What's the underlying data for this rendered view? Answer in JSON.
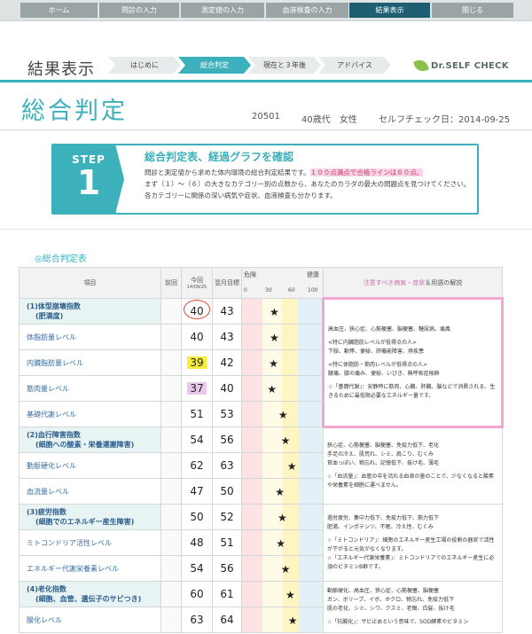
{
  "nav": {
    "items": [
      {
        "label": "ホーム"
      },
      {
        "label": "問診の入力"
      },
      {
        "label": "測定値の入力"
      },
      {
        "label": "血液検査の入力"
      },
      {
        "label": "結果表示"
      },
      {
        "label": "閉じる"
      }
    ],
    "active_index": 4
  },
  "header": {
    "title": "結果表示",
    "breadcrumbs": [
      "はじめに",
      "総合判定",
      "現在と３年後",
      "アドバイス"
    ],
    "active_crumb": 1,
    "logo_text": "Dr.SELF CHECK"
  },
  "page": {
    "title": "総合判定",
    "id": "20501",
    "profile": "40歳代　女性",
    "check_date": "セルフチェック日：2014-09-25"
  },
  "step": {
    "label": "STEP",
    "number": "1",
    "heading": "総合判定表、経過グラフを確認",
    "body_1": "問診と測定値から求めた体内環境の総合判定結果です。",
    "highlight": "１００点満点で合格ラインは６０点。",
    "body_2": "まず（１）～（６）の大きなカテゴリー別の点数から、あなたのカラダの最大の問題点を見つけてください。各カテゴリーに関係の深い病気や症状、血液検査も分かります。"
  },
  "section": {
    "title": "総合判定表",
    "bullet": "◎"
  },
  "table": {
    "headers": {
      "item": "項目",
      "prev": "前回",
      "now": "今回",
      "now_date": "14/09/25",
      "target": "翌月目標",
      "danger": "危険",
      "healthy": "健康",
      "ticks": [
        "0",
        "30",
        "60",
        "100"
      ],
      "notes_pink": "注意すべき病気・症状",
      "notes_rest": "＆用語の解説"
    },
    "rows": [
      {
        "item": "(1)体型崩壊指数",
        "item_sub": "(肥満度)",
        "category": true,
        "prev": "",
        "now": "40",
        "target": "43",
        "score": 40,
        "mark": "circle"
      },
      {
        "item": "体脂肪量レベル",
        "category": false,
        "prev": "",
        "now": "40",
        "target": "43",
        "score": 40,
        "mark": ""
      },
      {
        "item": "内臓脂肪量レベル",
        "category": false,
        "prev": "",
        "now": "39",
        "target": "42",
        "score": 39,
        "mark": "yellow"
      },
      {
        "item": "筋肉量レベル",
        "category": false,
        "prev": "",
        "now": "37",
        "target": "40",
        "score": 37,
        "mark": "purple"
      },
      {
        "item": "基礎代謝レベル",
        "category": false,
        "prev": "",
        "now": "51",
        "target": "53",
        "score": 51,
        "mark": ""
      },
      {
        "item": "(2)血行障害指数",
        "item_sub": "(細胞への酸素・栄養運搬障害)",
        "category": true,
        "prev": "",
        "now": "54",
        "target": "56",
        "score": 54,
        "mark": ""
      },
      {
        "item": "動脈硬化レベル",
        "category": false,
        "prev": "",
        "now": "62",
        "target": "63",
        "score": 62,
        "mark": ""
      },
      {
        "item": "血流量レベル",
        "category": false,
        "prev": "",
        "now": "47",
        "target": "50",
        "score": 47,
        "mark": ""
      },
      {
        "item": "(3)疲労指数",
        "item_sub": "(細胞でのエネルギー産生障害)",
        "category": true,
        "prev": "",
        "now": "50",
        "target": "52",
        "score": 50,
        "mark": ""
      },
      {
        "item": "ミトコンドリア活性レベル",
        "category": false,
        "prev": "",
        "now": "48",
        "target": "51",
        "score": 48,
        "mark": ""
      },
      {
        "item": "エネルギー代謝栄養素レベル",
        "category": false,
        "prev": "",
        "now": "54",
        "target": "56",
        "score": 54,
        "mark": ""
      },
      {
        "item": "(4)老化指数",
        "item_sub": "(細胞、血管、遺伝子のサビつき)",
        "category": true,
        "prev": "",
        "now": "60",
        "target": "61",
        "score": 60,
        "mark": ""
      },
      {
        "item": "酸化レベル",
        "category": false,
        "prev": "",
        "now": "63",
        "target": "64",
        "score": 63,
        "mark": ""
      }
    ],
    "notes": [
      {
        "lines": [
          "高血圧、狭心症、心筋梗塞、脳梗塞、糖尿病、痛風",
          "",
          "<特に内臓脂肪レベルが低得点の人>",
          "下肢、動悸、便秘、肝機能障害、痔疾患",
          "",
          "<特に体脂肪・筋肉レベルが低得点の人>",
          "腰痛、膝の痛み、便秘、いびき、無呼吸症候群",
          "",
          "☆「基礎代謝」：安静時に筋肉、心臓、肝臓、脳などで消費される、生きるために最低限必要なエネルギー量です。"
        ]
      },
      {
        "lines": [
          "狭心症、心筋梗塞、脳梗塞、免疫力低下、老化",
          "手足の冷え、肌荒れ、シミ、肩こり、むくみ",
          "貧血っぽい、物忘れ、記憶低下、抜け毛、薄毛",
          "",
          "☆「血流量」：血管の中を流れる血液の量のことで、少なくなると酸素や栄養素を細胞に運べません。"
        ]
      },
      {
        "lines": [
          "過労疲労、集中力低下、免疫力低下、筋力低下",
          "肥満、インポテンツ、不眠、冷え性、むくみ",
          "",
          "☆「ミトコンドリア」：細胞のエネルギー産生工場の役割の器官で活性が下がると元気がなくなります。",
          "☆「エネルギー代謝栄養素」：ミトコンドリアでのエネルギー産生に必須のビタミンB群です。"
        ]
      },
      {
        "lines": [
          "動脈硬化、高血圧、狭心症、心筋梗塞、脳梗塞",
          "ガン、ボリープ、イボ、ホクロ、物忘れ、免疫力低下",
          "肌の老化、シミ、シワ、クスミ、老眼、白髪、抜け毛",
          "",
          "☆「抗酸化」：サビ止めという意味で、SOD酵素やビタミン"
        ]
      }
    ]
  }
}
